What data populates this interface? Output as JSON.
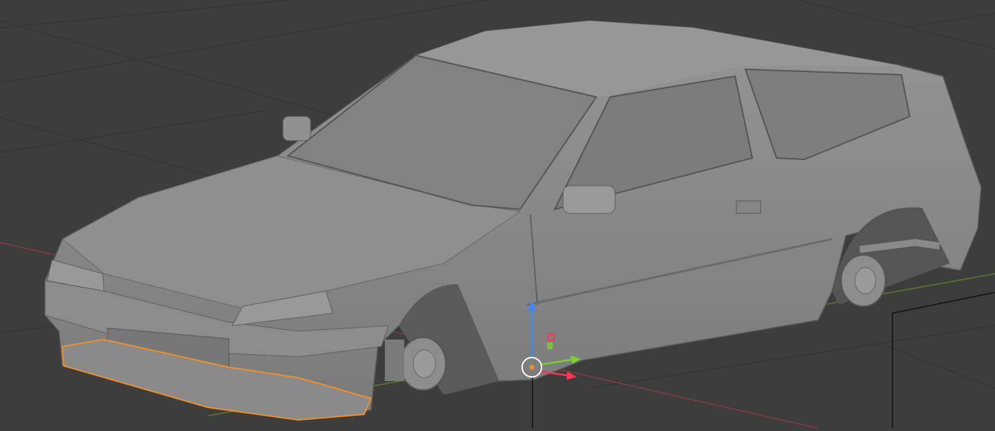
{
  "viewport": {
    "mode": "3d-viewport",
    "background_color": "#3d3d3d",
    "grid_color": "#353535",
    "x_axis_color": "#8a3a46",
    "y_axis_color": "#5b7a2a",
    "selection_color": "#f0902a"
  },
  "model": {
    "body_color": "#8a8a8a",
    "body_shadow_color": "#6e6e6e",
    "glass_color": "#7e7e7e",
    "arch_color": "#4a4a4a"
  },
  "gizmo": {
    "origin_icon": "object-origin-icon",
    "z_arrow_color": "#3b8bff",
    "y_arrow_color": "#7ad12f",
    "x_arrow_color": "#ff3352"
  }
}
